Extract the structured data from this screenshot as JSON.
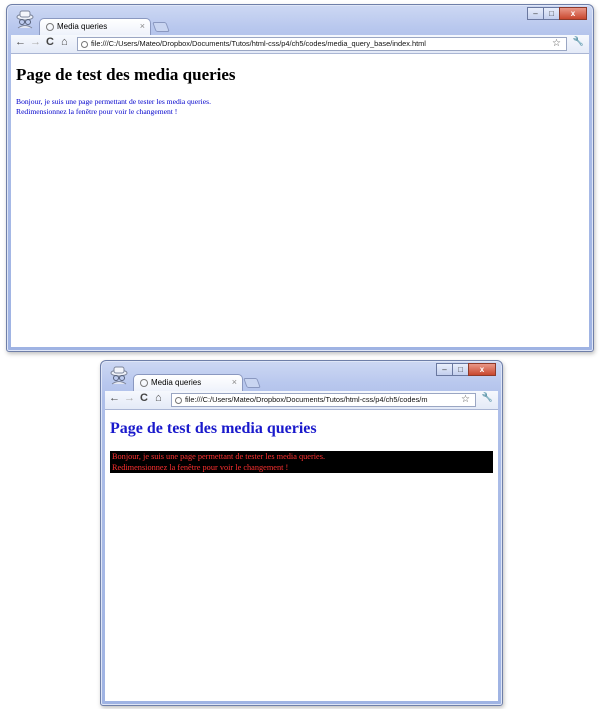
{
  "windows": [
    {
      "tab": {
        "title": "Media queries",
        "close": "×"
      },
      "toolbar": {
        "back": "←",
        "forward": "→",
        "reload": "C",
        "home": "⌂",
        "star": "☆",
        "wrench": "🔧"
      },
      "address": "file:///C:/Users/Mateo/Dropbox/Documents/Tutos/html-css/p4/ch5/codes/media_query_base/index.html",
      "controls": {
        "minimize": "–",
        "maximize": "□",
        "close": "x"
      },
      "page": {
        "heading": "Page de test des media queries",
        "line1": "Bonjour, je suis une page permettant de tester les media queries.",
        "line2": "Redimensionnez la fenêtre pour voir le changement !"
      }
    },
    {
      "tab": {
        "title": "Media queries",
        "close": "×"
      },
      "toolbar": {
        "back": "←",
        "forward": "→",
        "reload": "C",
        "home": "⌂",
        "star": "☆",
        "wrench": "🔧"
      },
      "address": "file:///C:/Users/Mateo/Dropbox/Documents/Tutos/html-css/p4/ch5/codes/m",
      "controls": {
        "minimize": "–",
        "maximize": "□",
        "close": "x"
      },
      "page": {
        "heading": "Page de test des media queries",
        "line1": "Bonjour, je suis une page permettant de tester les media queries.",
        "line2": "Redimensionnez la fenêtre pour voir le changement !"
      }
    }
  ],
  "colors": {
    "wide_text": "#0000cc",
    "narrow_heading": "#1a1acc",
    "narrow_text": "#ff3030",
    "narrow_background": "#000000"
  }
}
